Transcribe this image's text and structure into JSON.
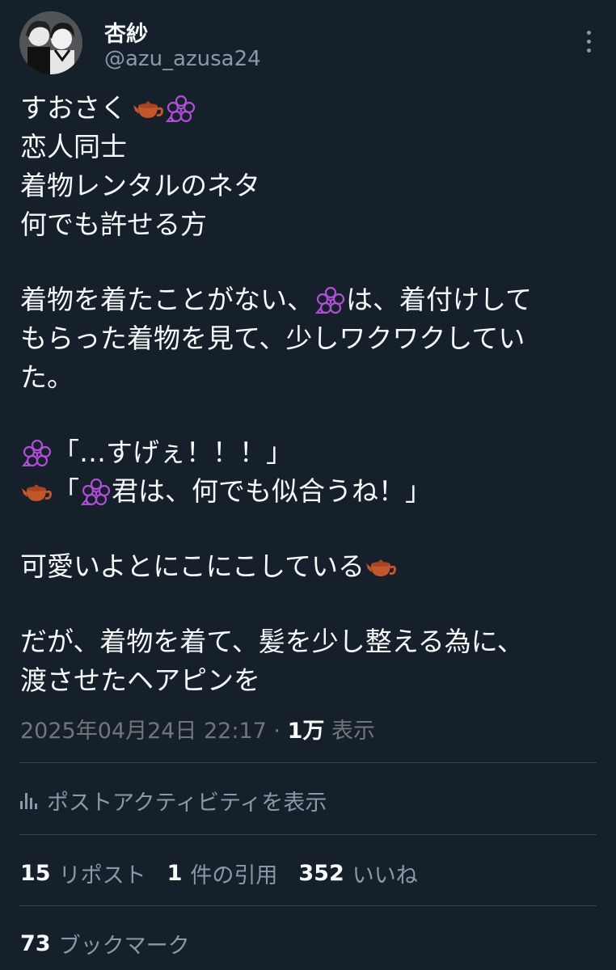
{
  "author": {
    "display_name": "杏紗",
    "handle": "@azu_azusa24",
    "avatar_icon": "monochrome-anime-avatar"
  },
  "menu_icon": "more-vertical-icon",
  "post": {
    "lines": [
      {
        "text_before": "すおさく",
        "emojis_after": [
          "teapot",
          "flower"
        ]
      },
      {
        "text": "恋人同士"
      },
      {
        "text": "着物レンタルのネタ"
      },
      {
        "text": "何でも許せる方"
      },
      {
        "blank": true
      },
      {
        "text_before": "着物を着たことがない、",
        "emojis_after": [
          "flower"
        ],
        "text_after": "は、着付けして"
      },
      {
        "text": "もらった着物を見て、少しワクワクしてい"
      },
      {
        "text": "た。"
      },
      {
        "blank": true
      },
      {
        "emojis_before": [
          "flower"
        ],
        "text_after": "「…すげぇ！！！」"
      },
      {
        "emojis_before": [
          "teapot"
        ],
        "text_after": "「",
        "emojis_after2": [
          "flower"
        ],
        "text_tail": "君は、何でも似合うね！」"
      },
      {
        "blank": true
      },
      {
        "text_before": "可愛いよとにこにこしている",
        "emojis_after": [
          "teapot"
        ]
      },
      {
        "blank": true
      },
      {
        "text": "だが、着物を着て、髪を少し整える為に、"
      },
      {
        "text": "渡させたヘアピンを"
      }
    ],
    "line_texts": {
      "l1": "すおさく",
      "l2": "恋人同士",
      "l3": "着物レンタルのネタ",
      "l4": "何でも許せる方",
      "l5a": "着物を着たことがない、",
      "l5b": "は、着付けして",
      "l6": "もらった着物を見て、少しワクワクしてい",
      "l7": "た。",
      "l8": "「…すげぇ！！！」",
      "l9a": "「",
      "l9b": "君は、何でも似合うね！」",
      "l10": "可愛いよとにこにこしている",
      "l11": "だが、着物を着て、髪を少し整える為に、",
      "l12": "渡させたヘアピンを"
    },
    "emoji_names": {
      "teapot": "teapot-emoji",
      "flower": "cherry-blossom-outline-emoji"
    }
  },
  "meta": {
    "datetime": "2025年04月24日 22:17",
    "separator": " · ",
    "views_count": "1万",
    "views_label": " 表示"
  },
  "activity": {
    "icon": "analytics-bars-icon",
    "label": "ポストアクティビティを表示"
  },
  "stats": {
    "reposts": {
      "count": "15",
      "label": "リポスト"
    },
    "quotes": {
      "count": "1",
      "label": "件の引用"
    },
    "likes": {
      "count": "352",
      "label": "いいね"
    }
  },
  "bookmarks": {
    "count": "73",
    "label": "ブックマーク"
  },
  "colors": {
    "background": "#15202b",
    "text_primary": "#f7f9f9",
    "text_secondary": "#8b98a5",
    "divider": "#38444d",
    "teapot": "#c2572e",
    "flower": "#b24dd8"
  }
}
